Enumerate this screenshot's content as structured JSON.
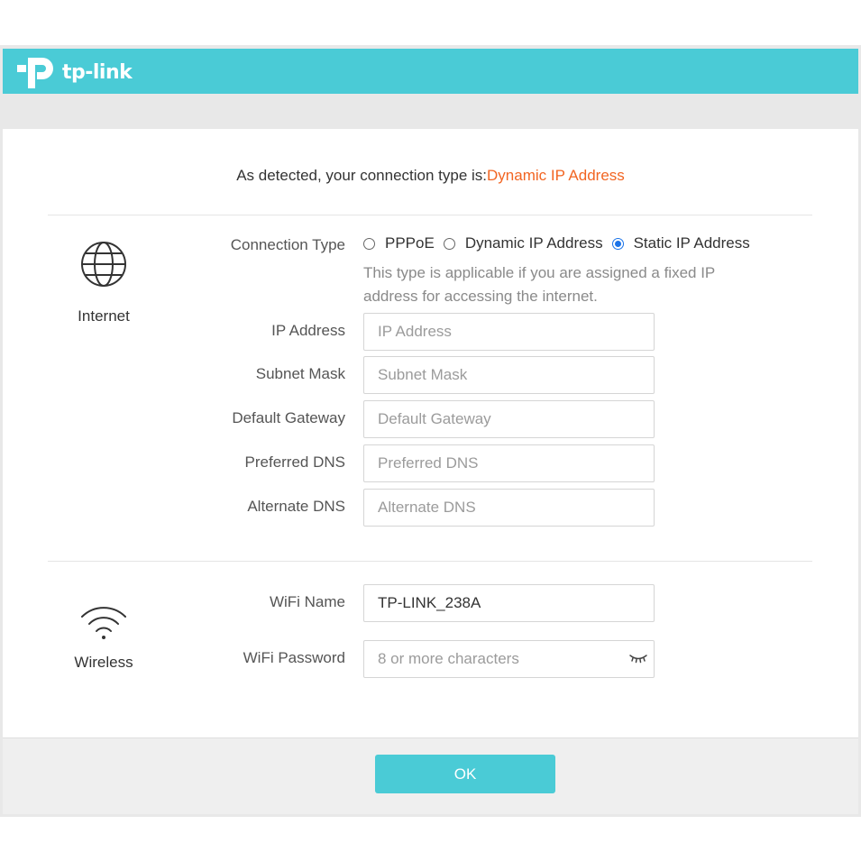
{
  "header": {
    "brand": "tp-link",
    "bg_color": "#4acbd6"
  },
  "detected": {
    "prefix": "As detected, your connection type is:",
    "type": "Dynamic IP Address",
    "type_color": "#f26522"
  },
  "internet": {
    "section_label": "Internet",
    "icon": "globe-icon",
    "connection_type_label": "Connection Type",
    "connection_options": [
      {
        "label": "PPPoE",
        "checked": false
      },
      {
        "label": "Dynamic IP Address",
        "checked": false
      },
      {
        "label": "Static IP Address",
        "checked": true
      }
    ],
    "hint": "This type is applicable if you are assigned a fixed IP address for accessing the internet.",
    "fields": [
      {
        "label": "IP Address",
        "placeholder": "IP Address",
        "value": ""
      },
      {
        "label": "Subnet Mask",
        "placeholder": "Subnet Mask",
        "value": ""
      },
      {
        "label": "Default Gateway",
        "placeholder": "Default Gateway",
        "value": ""
      },
      {
        "label": "Preferred DNS",
        "placeholder": "Preferred DNS",
        "value": ""
      },
      {
        "label": "Alternate DNS",
        "placeholder": "Alternate DNS",
        "value": ""
      }
    ]
  },
  "wireless": {
    "section_label": "Wireless",
    "icon": "wifi-icon",
    "wifi_name_label": "WiFi Name",
    "wifi_name_value": "TP-LINK_238A",
    "wifi_password_label": "WiFi Password",
    "wifi_password_placeholder": "8 or more characters",
    "password_toggle_icon": "eye-closed-icon"
  },
  "footer": {
    "ok_label": "OK",
    "accent": "#4acbd6"
  }
}
